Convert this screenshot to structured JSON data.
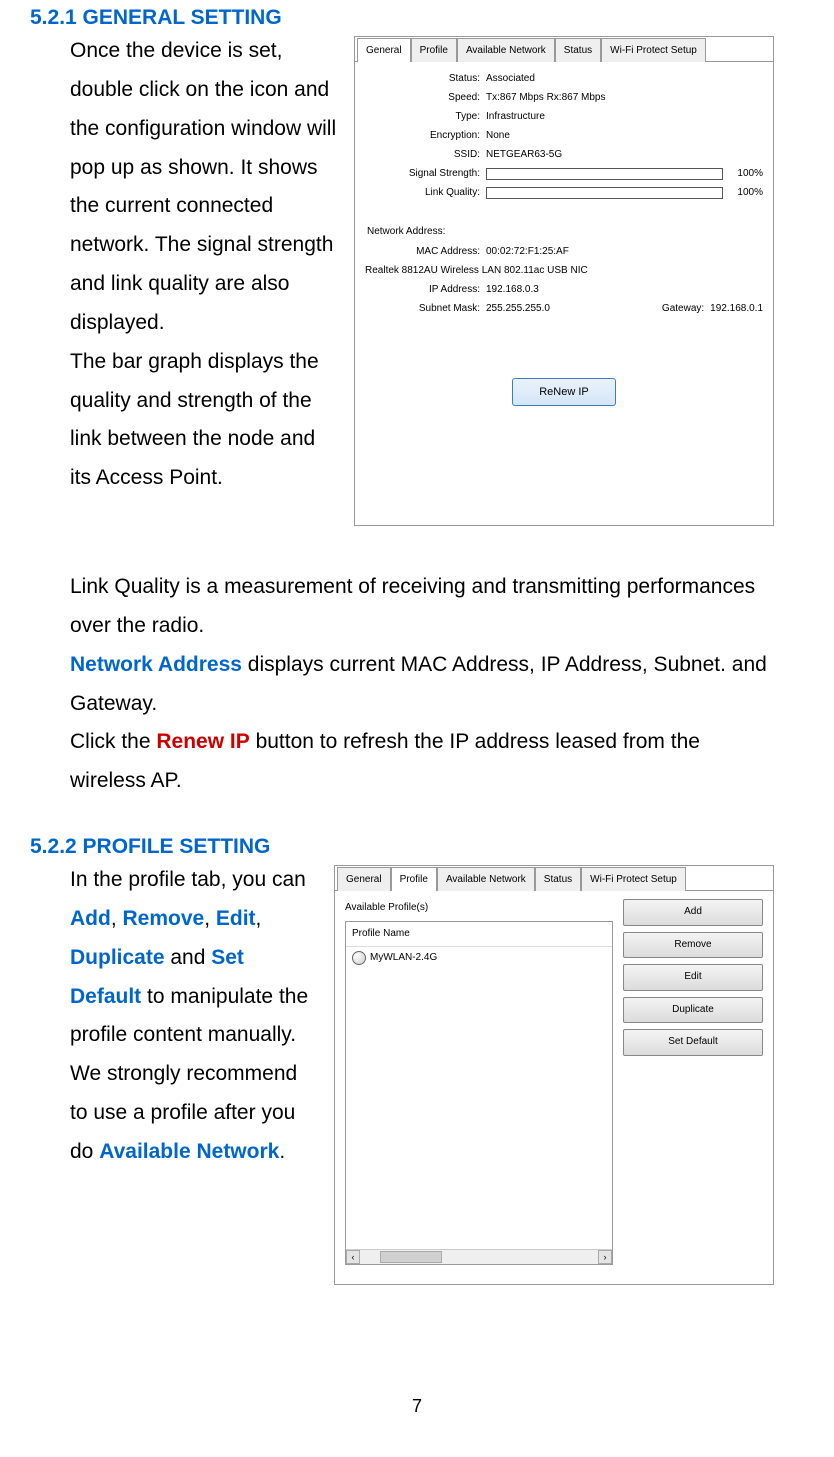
{
  "page_number": "7",
  "sections": {
    "s1": {
      "title": "5.2.1 GENERAL SETTING",
      "p1": "Once the device is set, double click on the icon and the configuration window will pop up as shown. It shows the current connected network. The signal strength and link quality are also displayed.",
      "p2": "The bar graph displays the quality and strength of the link between the node and its Access Point.",
      "p3": "Link Quality is a measurement of receiving and transmitting performances over the radio.",
      "p4a": "Network Address",
      "p4b": " displays current MAC Address, IP Address, Subnet. and Gateway.",
      "p5a": "Click the ",
      "p5b": "Renew IP",
      "p5c": " button to refresh the IP address leased from the wireless AP."
    },
    "s2": {
      "title": "5.2.2 PROFILE SETTING",
      "t1": "In the profile tab, you can ",
      "add": "Add",
      "c1": ", ",
      "remove": "Remove",
      "c2": ", ",
      "edit": "Edit",
      "c3": ", ",
      "dup": "Duplicate",
      "c4": " and ",
      "setdef": "Set Default",
      "t2": " to manipulate the profile content manually.",
      "t3": "We strongly recommend to use a profile after you do ",
      "availnet": "Available Network",
      "t4": "."
    }
  },
  "fig1": {
    "tabs": [
      "General",
      "Profile",
      "Available Network",
      "Status",
      "Wi-Fi Protect Setup"
    ],
    "active_tab": 0,
    "labels": {
      "status": "Status:",
      "speed": "Speed:",
      "type": "Type:",
      "encryption": "Encryption:",
      "ssid": "SSID:",
      "signal": "Signal Strength:",
      "link": "Link Quality:",
      "netaddr": "Network Address:",
      "mac": "MAC Address:",
      "adapter": "Realtek 8812AU Wireless LAN 802.11ac USB NIC",
      "ip": "IP Address:",
      "subnet": "Subnet Mask:",
      "gateway": "Gateway:",
      "renew": "ReNew IP"
    },
    "values": {
      "status": "Associated",
      "speed": "Tx:867 Mbps Rx:867 Mbps",
      "type": "Infrastructure",
      "encryption": "None",
      "ssid": "NETGEAR63-5G",
      "signal_pct": "100%",
      "link_pct": "100%",
      "mac": "00:02:72:F1:25:AF",
      "ip": "192.168.0.3",
      "subnet": "255.255.255.0",
      "gateway": "192.168.0.1"
    }
  },
  "fig2": {
    "tabs": [
      "General",
      "Profile",
      "Available Network",
      "Status",
      "Wi-Fi Protect Setup"
    ],
    "active_tab": 1,
    "available_label": "Available Profile(s)",
    "column_header": "Profile Name",
    "profile_item": "MyWLAN-2.4G",
    "buttons": {
      "add": "Add",
      "remove": "Remove",
      "edit": "Edit",
      "dup": "Duplicate",
      "setdef": "Set Default"
    }
  }
}
